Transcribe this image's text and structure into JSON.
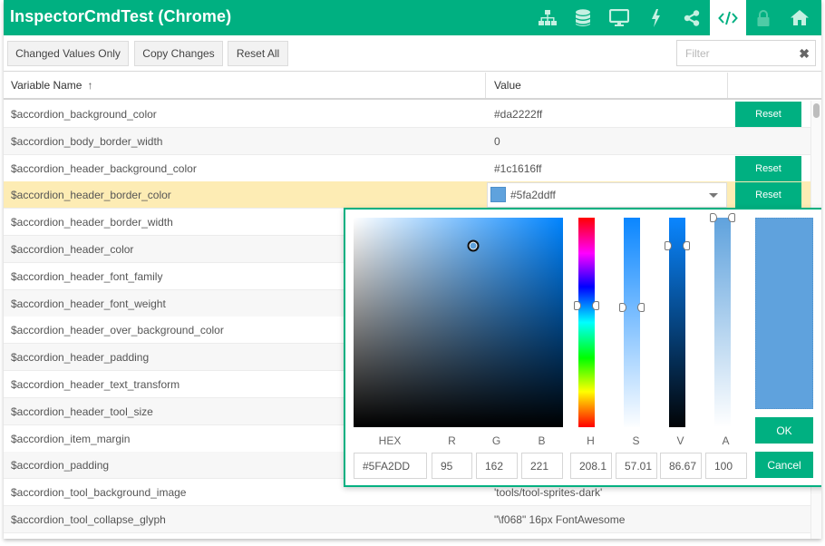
{
  "window": {
    "title": "InspectorCmdTest (Chrome)",
    "nav_icons": [
      {
        "name": "sitemap-icon",
        "active": false
      },
      {
        "name": "database-icon",
        "active": false
      },
      {
        "name": "desktop-icon",
        "active": false
      },
      {
        "name": "bolt-icon",
        "active": false
      },
      {
        "name": "share-icon",
        "active": false
      },
      {
        "name": "code-icon",
        "active": true
      },
      {
        "name": "lock-icon",
        "active": false,
        "disabled": true
      },
      {
        "name": "home-icon",
        "active": false
      }
    ]
  },
  "toolbar": {
    "changed_values_label": "Changed Values Only",
    "copy_changes_label": "Copy Changes",
    "reset_all_label": "Reset All",
    "filter_placeholder": "Filter",
    "filter_value": "",
    "clear_glyph": "✖"
  },
  "table": {
    "columns": [
      "Variable Name",
      "Value",
      ""
    ],
    "sort_glyph": "↑",
    "rows": [
      {
        "name": "$accordion_background_color",
        "value": "#da2222ff",
        "reset": "Reset"
      },
      {
        "name": "$accordion_body_border_width",
        "value": "0",
        "reset": ""
      },
      {
        "name": "$accordion_header_background_color",
        "value": "#1c1616ff",
        "reset": "Reset"
      },
      {
        "name": "$accordion_header_border_color",
        "value": "#5fa2ddff",
        "reset": "Reset",
        "selected": true,
        "swatch": "#5fa2dd"
      },
      {
        "name": "$accordion_header_border_width",
        "value": "",
        "reset": ""
      },
      {
        "name": "$accordion_header_color",
        "value": "",
        "reset": ""
      },
      {
        "name": "$accordion_header_font_family",
        "value": "",
        "reset": ""
      },
      {
        "name": "$accordion_header_font_weight",
        "value": "",
        "reset": ""
      },
      {
        "name": "$accordion_header_over_background_color",
        "value": "",
        "reset": ""
      },
      {
        "name": "$accordion_header_padding",
        "value": "",
        "reset": ""
      },
      {
        "name": "$accordion_header_text_transform",
        "value": "",
        "reset": ""
      },
      {
        "name": "$accordion_header_tool_size",
        "value": "",
        "reset": ""
      },
      {
        "name": "$accordion_item_margin",
        "value": "",
        "reset": ""
      },
      {
        "name": "$accordion_padding",
        "value": "",
        "reset": ""
      },
      {
        "name": "$accordion_tool_background_image",
        "value": "'tools/tool-sprites-dark'",
        "reset": ""
      },
      {
        "name": "$accordion_tool_collapse_glyph",
        "value": "\"\\f068\" 16px FontAwesome",
        "reset": ""
      }
    ]
  },
  "color_picker": {
    "color": "#5fa2dd",
    "labels": {
      "hex": "HEX",
      "r": "R",
      "g": "G",
      "b": "B",
      "h": "H",
      "s": "S",
      "v": "V",
      "a": "A"
    },
    "values": {
      "hex": "#5FA2DD",
      "r": "95",
      "g": "162",
      "b": "221",
      "h": "208.1",
      "s": "57.01",
      "v": "86.67",
      "a": "100"
    },
    "hue_deg": 208.1,
    "saturation_pct": 57.0,
    "value_pct": 86.7,
    "alpha_pct": 100,
    "ok_label": "OK",
    "cancel_label": "Cancel"
  }
}
